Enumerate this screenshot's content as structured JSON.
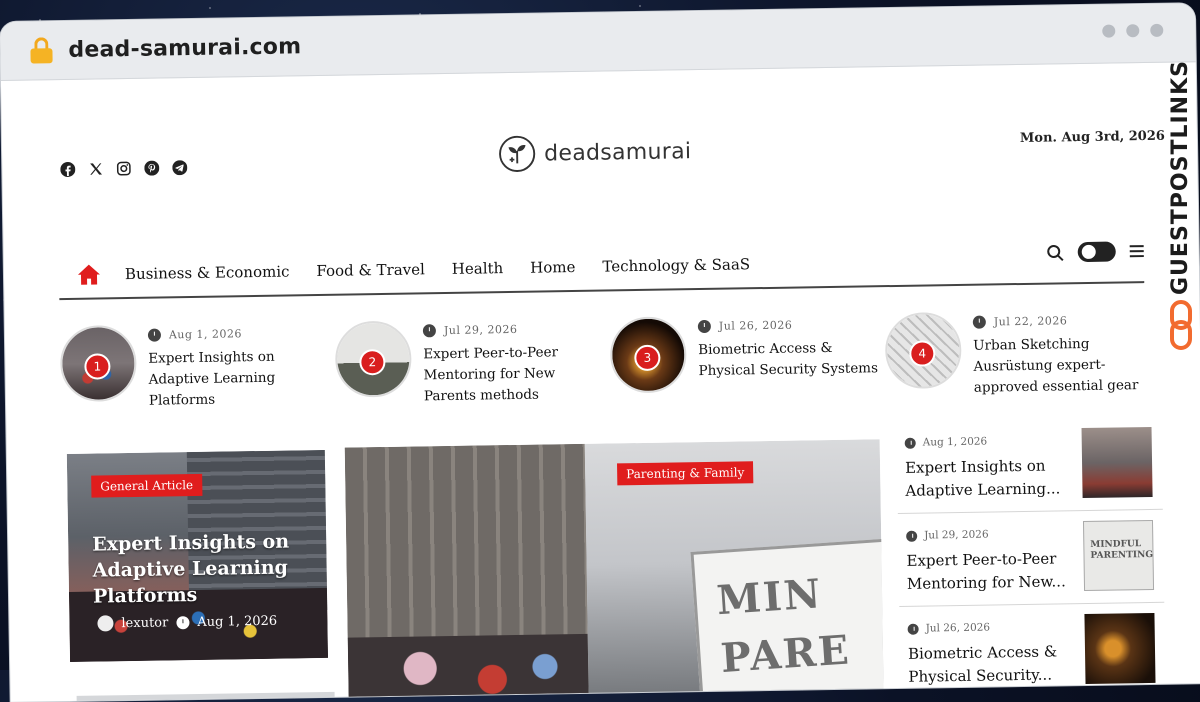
{
  "browser": {
    "url": "dead-samurai.com"
  },
  "site": {
    "logo_text": "deadsamurai",
    "date": "Mon. Aug 3rd, 2026"
  },
  "social": [
    "facebook-icon",
    "x-icon",
    "instagram-icon",
    "pinterest-icon",
    "telegram-icon"
  ],
  "nav": {
    "items": [
      "Business & Economic",
      "Food & Travel",
      "Health",
      "Home",
      "Technology & SaaS"
    ]
  },
  "ticker": [
    {
      "num": "1",
      "date": "Aug 1, 2026",
      "title": "Expert Insights on Adaptive Learning Platforms"
    },
    {
      "num": "2",
      "date": "Jul 29, 2026",
      "title": "Expert Peer-to-Peer Mentoring for New Parents methods"
    },
    {
      "num": "3",
      "date": "Jul 26, 2026",
      "title": "Biometric Access & Physical Security Systems"
    },
    {
      "num": "4",
      "date": "Jul 22, 2026",
      "title": "Urban Sketching Ausrüstung expert-approved essential gear"
    }
  ],
  "card_left": {
    "category": "General Article",
    "title": "Expert Insights on Adaptive Learning Platforms",
    "author": "lexutor",
    "date": "Aug 1, 2026"
  },
  "hero": {
    "category": "Parenting & Family",
    "sign_line1": "MIN",
    "sign_line2": "PARE"
  },
  "sidebar": [
    {
      "date": "Aug 1, 2026",
      "title": "Expert Insights on Adaptive Learning...",
      "thumb_label": ""
    },
    {
      "date": "Jul 29, 2026",
      "title": "Expert Peer-to-Peer Mentoring for New...",
      "thumb_label": "MINDFUL PARENTING"
    },
    {
      "date": "Jul 26, 2026",
      "title": "Biometric Access & Physical Security...",
      "thumb_label": ""
    }
  ],
  "watermark": {
    "text": "GUESTPOSTLINKS"
  },
  "colors": {
    "accent": "#e01d1d",
    "lock": "#f5b324",
    "watermark_chain": "#f26b2f"
  }
}
